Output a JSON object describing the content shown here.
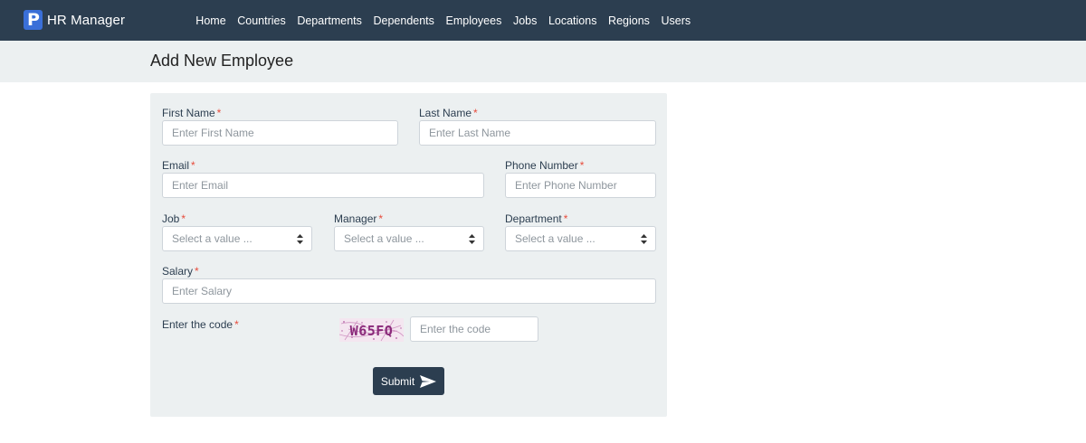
{
  "app": {
    "logo_letter": "P",
    "brand": "HR Manager"
  },
  "nav": {
    "items": [
      {
        "label": "Home"
      },
      {
        "label": "Countries"
      },
      {
        "label": "Departments"
      },
      {
        "label": "Dependents"
      },
      {
        "label": "Employees"
      },
      {
        "label": "Jobs"
      },
      {
        "label": "Locations"
      },
      {
        "label": "Regions"
      },
      {
        "label": "Users"
      }
    ]
  },
  "page": {
    "title": "Add New Employee"
  },
  "form": {
    "required_marker": "*",
    "first_name": {
      "label": "First Name",
      "placeholder": "Enter First Name"
    },
    "last_name": {
      "label": "Last Name",
      "placeholder": "Enter Last Name"
    },
    "email": {
      "label": "Email",
      "placeholder": "Enter Email"
    },
    "phone": {
      "label": "Phone Number",
      "placeholder": "Enter Phone Number"
    },
    "job": {
      "label": "Job",
      "selected": "Select a value ..."
    },
    "manager": {
      "label": "Manager",
      "selected": "Select a value ..."
    },
    "department": {
      "label": "Department",
      "selected": "Select a value ..."
    },
    "salary": {
      "label": "Salary",
      "placeholder": "Enter Salary"
    },
    "code": {
      "label": "Enter the code",
      "placeholder": "Enter the code",
      "captcha_text": "W65FQ"
    },
    "submit_label": "Submit"
  },
  "colors": {
    "navbar": "#2c3e50",
    "logo": "#3a6fd8",
    "page_header_bg": "#ecf0f1",
    "required": "#e74c3c",
    "captcha_text": "#8a2a7a"
  },
  "icons": {
    "select_caret": "sort-caret-icon",
    "submit": "paper-plane-icon"
  }
}
